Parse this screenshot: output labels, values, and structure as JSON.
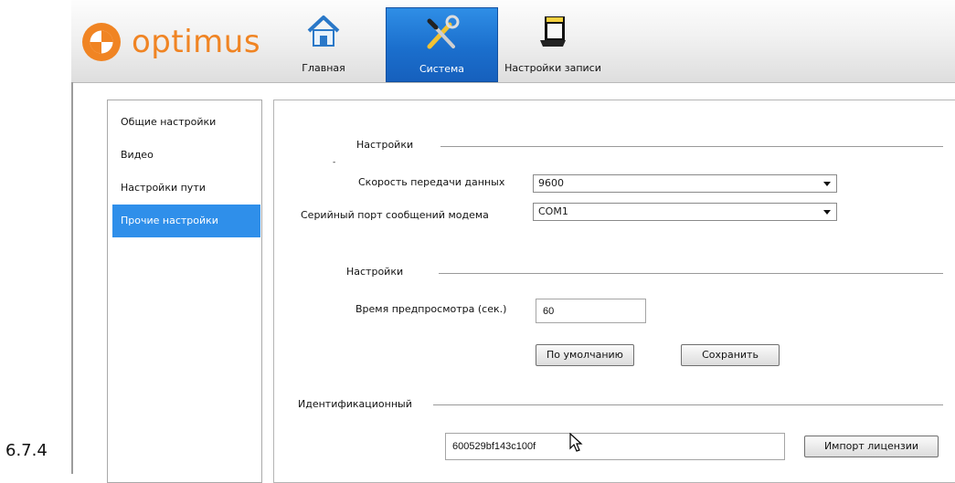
{
  "app": {
    "logo_text": "optimus"
  },
  "tabs": [
    {
      "label": "Главная",
      "icon": "home-icon"
    },
    {
      "label": "Система",
      "icon": "tools-icon",
      "active": true
    },
    {
      "label": "Настройки записи",
      "icon": "record-settings-icon"
    }
  ],
  "sidebar": {
    "items": [
      {
        "label": "Общие настройки"
      },
      {
        "label": "Видео"
      },
      {
        "label": "Настройки пути"
      },
      {
        "label": "Прочие настройки",
        "active": true
      }
    ]
  },
  "section1": {
    "title": "Настройки",
    "baud_label": "Скорость передачи данных",
    "baud_value": "9600",
    "port_label": "Серийный порт сообщений модема",
    "port_value": "COM1"
  },
  "section2": {
    "title": "Настройки",
    "preview_label": "Время предпросмотра (сек.)",
    "preview_value": "60",
    "default_button": "По умолчанию",
    "save_button": "Сохранить"
  },
  "section3": {
    "title": "Идентификационный",
    "id_value": "600529bf143c100f",
    "import_button": "Импорт лицензии"
  },
  "figure_label": "6.7.4",
  "colors": {
    "accent": "#f08423",
    "active_blue": "#2f8fea"
  }
}
